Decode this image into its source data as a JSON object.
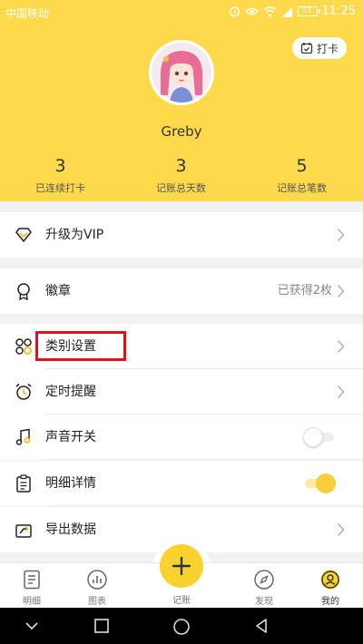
{
  "status_bar": {
    "carrier": "中国移动",
    "battery": "51",
    "time": "11:25"
  },
  "header": {
    "checkin_label": "打卡",
    "username": "Greby",
    "stats": [
      {
        "value": "3",
        "label": "已连续打卡"
      },
      {
        "value": "3",
        "label": "记账总天数"
      },
      {
        "value": "5",
        "label": "记账总笔数"
      }
    ]
  },
  "menu": {
    "vip": {
      "label": "升级为VIP",
      "icon": "diamond-icon"
    },
    "badge": {
      "label": "徽章",
      "icon": "medal-icon",
      "extra": "已获得2枚"
    },
    "category": {
      "label": "类别设置",
      "icon": "category-grid-icon"
    },
    "reminder": {
      "label": "定时提醒",
      "icon": "alarm-clock-icon"
    },
    "sound": {
      "label": "声音开关",
      "icon": "music-note-icon",
      "enabled": false
    },
    "detail": {
      "label": "明细详情",
      "icon": "clipboard-icon",
      "enabled": true
    },
    "export": {
      "label": "导出数据",
      "icon": "export-icon"
    }
  },
  "tabs": [
    {
      "label": "明细",
      "icon": "ledger-icon"
    },
    {
      "label": "图表",
      "icon": "chart-icon"
    },
    {
      "label": "记账",
      "icon": "plus-icon"
    },
    {
      "label": "发现",
      "icon": "compass-icon"
    },
    {
      "label": "我的",
      "icon": "profile-icon"
    }
  ],
  "colors": {
    "accent": "#fed94b",
    "highlight_box": "#e2121c"
  }
}
